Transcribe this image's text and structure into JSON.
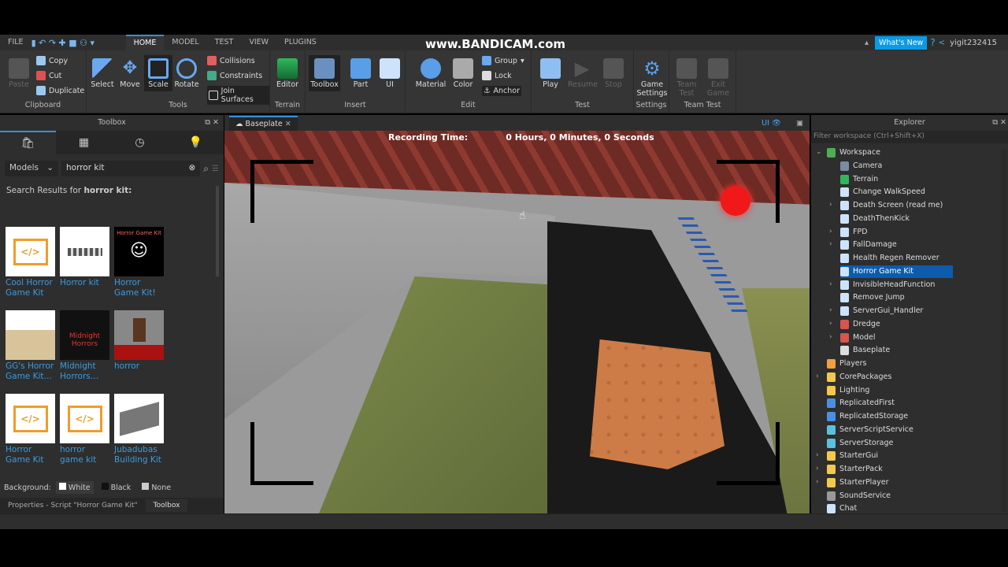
{
  "watermark": "www.BANDICAM.com",
  "menu": {
    "items": [
      "FILE",
      "HOME",
      "MODEL",
      "TEST",
      "VIEW",
      "PLUGINS"
    ],
    "active": "HOME"
  },
  "top_right": {
    "whats_new": "What's New",
    "user": "yigit232415"
  },
  "ribbon": {
    "clipboard": {
      "label": "Clipboard",
      "paste": "Paste",
      "copy": "Copy",
      "cut": "Cut",
      "duplicate": "Duplicate"
    },
    "tools": {
      "label": "Tools",
      "select": "Select",
      "move": "Move",
      "scale": "Scale",
      "rotate": "Rotate",
      "collisions": "Collisions",
      "constraints": "Constraints",
      "join": "Join Surfaces"
    },
    "terrain": {
      "label": "Terrain",
      "editor": "Editor"
    },
    "insert": {
      "label": "Insert",
      "toolbox": "Toolbox",
      "part": "Part",
      "ui": "UI"
    },
    "edit": {
      "label": "Edit",
      "material": "Material",
      "color": "Color",
      "group": "Group",
      "lock": "Lock",
      "anchor": "Anchor"
    },
    "test": {
      "label": "Test",
      "play": "Play",
      "resume": "Resume",
      "stop": "Stop"
    },
    "settings": {
      "label": "Settings",
      "game1": "Game",
      "game2": "Settings"
    },
    "teamtest": {
      "label": "Team Test",
      "team1": "Team",
      "team2": "Test",
      "exit1": "Exit",
      "exit2": "Game"
    }
  },
  "toolbox": {
    "title": "Toolbox",
    "category": "Models",
    "search": "horror kit",
    "results_prefix": "Search Results for",
    "results_query": "horror kit:",
    "items": [
      {
        "name": "Cool Horror Game Kit",
        "thumb": "script"
      },
      {
        "name": "Horror kit",
        "thumb": "parts"
      },
      {
        "name": "Horror Game Kit!",
        "thumb": "smiley",
        "thumb_text": "Horror Game Kit"
      },
      {
        "name": "GG's Horror Game Kit…",
        "thumb": "table"
      },
      {
        "name": "Midnight Horrors…",
        "thumb": "midnight",
        "thumb_text": "Midnight Horrors"
      },
      {
        "name": "horror",
        "thumb": "door"
      },
      {
        "name": "Horror Game Kit",
        "thumb": "script"
      },
      {
        "name": "horror game kit",
        "thumb": "script"
      },
      {
        "name": "Jubadubas Building Kit",
        "thumb": "building"
      }
    ],
    "background_label": "Background:",
    "bg_options": [
      "White",
      "Black",
      "None"
    ]
  },
  "bottom_tabs": {
    "properties": "Properties - Script \"Horror Game Kit\"",
    "toolbox": "Toolbox"
  },
  "viewport": {
    "tab": "Baseplate",
    "ui_toggle": "UI",
    "recording_label": "Recording Time:",
    "recording_value": "0 Hours, 0 Minutes, 0 Seconds"
  },
  "explorer": {
    "title": "Explorer",
    "filter_placeholder": "Filter workspace (Ctrl+Shift+X)",
    "items": [
      {
        "label": "Workspace",
        "depth": 0,
        "expand": "open",
        "icon": "#4caf50"
      },
      {
        "label": "Camera",
        "depth": 1,
        "icon": "#7a8ca0"
      },
      {
        "label": "Terrain",
        "depth": 1,
        "icon": "#2eb85c"
      },
      {
        "label": "Change WalkSpeed",
        "depth": 1,
        "icon": "#cde3fb"
      },
      {
        "label": "Death Screen (read me)",
        "depth": 1,
        "expand": "closed",
        "icon": "#cde3fb"
      },
      {
        "label": "DeathThenKick",
        "depth": 1,
        "icon": "#cde3fb"
      },
      {
        "label": "FPD",
        "depth": 1,
        "expand": "closed",
        "icon": "#cde3fb"
      },
      {
        "label": "FallDamage",
        "depth": 1,
        "expand": "closed",
        "icon": "#cde3fb"
      },
      {
        "label": "Health Regen Remover",
        "depth": 1,
        "icon": "#cde3fb"
      },
      {
        "label": "Horror Game Kit",
        "depth": 1,
        "selected": true,
        "icon": "#cde3fb"
      },
      {
        "label": "InvisibleHeadFunction",
        "depth": 1,
        "expand": "closed",
        "icon": "#cde3fb"
      },
      {
        "label": "Remove Jump",
        "depth": 1,
        "icon": "#cde3fb"
      },
      {
        "label": "ServerGui_Handler",
        "depth": 1,
        "expand": "closed",
        "icon": "#cde3fb"
      },
      {
        "label": "Dredge",
        "depth": 1,
        "expand": "closed",
        "icon": "#d9534f"
      },
      {
        "label": "Model",
        "depth": 1,
        "expand": "closed",
        "icon": "#d9534f"
      },
      {
        "label": "Baseplate",
        "depth": 1,
        "icon": "#ddd"
      },
      {
        "label": "Players",
        "depth": 0,
        "icon": "#f0a040"
      },
      {
        "label": "CorePackages",
        "depth": 0,
        "expand": "closed",
        "icon": "#f2c94c"
      },
      {
        "label": "Lighting",
        "depth": 0,
        "icon": "#f2c94c"
      },
      {
        "label": "ReplicatedFirst",
        "depth": 0,
        "icon": "#4a90e2"
      },
      {
        "label": "ReplicatedStorage",
        "depth": 0,
        "icon": "#4a90e2"
      },
      {
        "label": "ServerScriptService",
        "depth": 0,
        "icon": "#5bc0de"
      },
      {
        "label": "ServerStorage",
        "depth": 0,
        "icon": "#5bc0de"
      },
      {
        "label": "StarterGui",
        "depth": 0,
        "expand": "closed",
        "icon": "#f2c94c"
      },
      {
        "label": "StarterPack",
        "depth": 0,
        "expand": "closed",
        "icon": "#f2c94c"
      },
      {
        "label": "StarterPlayer",
        "depth": 0,
        "expand": "closed",
        "icon": "#f2c94c"
      },
      {
        "label": "SoundService",
        "depth": 0,
        "icon": "#999"
      },
      {
        "label": "Chat",
        "depth": 0,
        "icon": "#cde3fb"
      }
    ]
  },
  "colors": {
    "accent": "#3a8fd6",
    "selection": "#0b5cad",
    "link": "#3b9be0",
    "whats_new": "#0a9ae8"
  }
}
